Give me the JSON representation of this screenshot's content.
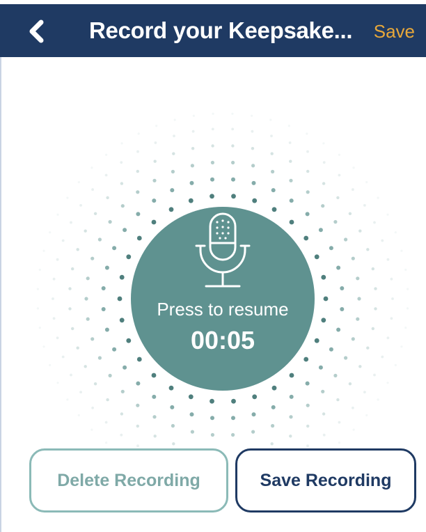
{
  "nav": {
    "back_icon": "chevron-left-icon",
    "title": "Record your Keepsake...",
    "save_label": "Save"
  },
  "recorder": {
    "icon": "microphone-icon",
    "prompt": "Press to resume",
    "timer": "00:05"
  },
  "actions": {
    "delete_label": "Delete Recording",
    "save_label": "Save Recording"
  },
  "colors": {
    "nav_background": "#1f3a63",
    "nav_save": "#e8a83a",
    "record_circle": "#5f9290",
    "delete_border": "#8bbab7",
    "save_border": "#1f3a63"
  }
}
